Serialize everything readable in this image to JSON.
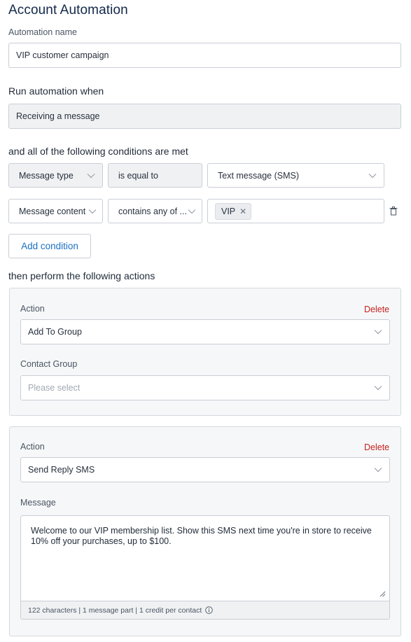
{
  "page": {
    "title": "Account Automation"
  },
  "name_field": {
    "label": "Automation name",
    "value": "VIP customer campaign"
  },
  "trigger": {
    "label": "Run automation when",
    "value": "Receiving a message"
  },
  "conditions": {
    "label": "and all of the following conditions are met",
    "rows": [
      {
        "field": "Message type",
        "operator": "is equal to",
        "value": "Text message (SMS)"
      },
      {
        "field": "Message content",
        "operator": "contains any of ...",
        "tags": [
          "VIP"
        ]
      }
    ],
    "add_button": "Add condition"
  },
  "actions": {
    "label": "then perform the following actions",
    "items": [
      {
        "action_label": "Action",
        "delete_label": "Delete",
        "action_value": "Add To Group",
        "sub_label": "Contact Group",
        "sub_placeholder": "Please select"
      },
      {
        "action_label": "Action",
        "delete_label": "Delete",
        "action_value": "Send Reply SMS",
        "sub_label": "Message",
        "message_text": "Welcome to our VIP membership list. Show this SMS next time you're in store to receive 10% off your purchases, up to $100.",
        "counter": "122 characters | 1 message part | 1 credit per contact"
      }
    ]
  },
  "icons": {
    "chevron": "chevron-down-icon",
    "trash": "trash-icon",
    "info": "info-icon",
    "remove": "close-icon"
  },
  "colors": {
    "title": "#12284a",
    "link": "#1c70c4",
    "danger": "#c71f1f",
    "border": "#c9ced6",
    "card_bg": "#f6f7f8",
    "disabled_bg": "#f0f1f3"
  }
}
